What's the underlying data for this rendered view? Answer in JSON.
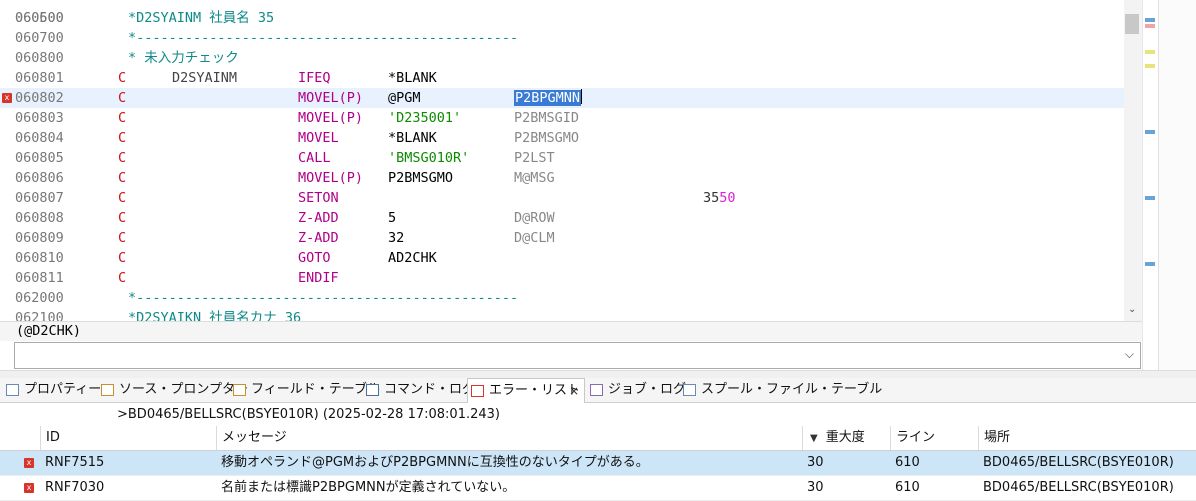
{
  "editor": {
    "top_partial": "060500",
    "lines": [
      {
        "seq": "060600",
        "type": "comment",
        "text": "*D2SYAINM 社員名 35"
      },
      {
        "seq": "060700",
        "type": "comment",
        "text": "*-----------------------------------------------"
      },
      {
        "seq": "060800",
        "type": "comment",
        "text": "* 未入力チェック"
      },
      {
        "seq": "060801",
        "type": "calc",
        "spec": "C",
        "f1": "D2SYAINM",
        "op": "IFEQ",
        "f2": "*BLANK",
        "res": "",
        "ind": ""
      },
      {
        "seq": "060802",
        "type": "calc",
        "error": true,
        "current": true,
        "spec": "C",
        "f1": "",
        "op": "MOVEL(P)",
        "f2": "@PGM",
        "res": "P2BPGMNN",
        "selected": true
      },
      {
        "seq": "060803",
        "type": "calc",
        "spec": "C",
        "f1": "",
        "op": "MOVEL(P)",
        "f2": "'D235001'",
        "literal": true,
        "res": "P2BMSGID"
      },
      {
        "seq": "060804",
        "type": "calc",
        "spec": "C",
        "f1": "",
        "op": "MOVEL",
        "f2": "*BLANK",
        "res": "P2BMSGMO"
      },
      {
        "seq": "060805",
        "type": "calc",
        "spec": "C",
        "f1": "",
        "op": "CALL",
        "f2": "'BMSG010R'",
        "literal": true,
        "res": "P2LST"
      },
      {
        "seq": "060806",
        "type": "calc",
        "spec": "C",
        "f1": "",
        "op": "MOVEL(P)",
        "f2": "P2BMSGMO",
        "res": "M@MSG"
      },
      {
        "seq": "060807",
        "type": "calc",
        "spec": "C",
        "f1": "",
        "op": "SETON",
        "f2": "",
        "res": "",
        "ind": "35",
        "ind2": "50"
      },
      {
        "seq": "060808",
        "type": "calc",
        "spec": "C",
        "f1": "",
        "op": "Z-ADD",
        "f2": "5",
        "res": "D@ROW"
      },
      {
        "seq": "060809",
        "type": "calc",
        "spec": "C",
        "f1": "",
        "op": "Z-ADD",
        "f2": "32",
        "res": "D@CLM"
      },
      {
        "seq": "060810",
        "type": "calc",
        "spec": "C",
        "f1": "",
        "op": "GOTO",
        "f2": "AD2CHK",
        "res": ""
      },
      {
        "seq": "060811",
        "type": "calc",
        "spec": "C",
        "f1": "",
        "op": "ENDIF",
        "f2": "",
        "res": ""
      },
      {
        "seq": "062000",
        "type": "comment",
        "text": "*-----------------------------------------------"
      },
      {
        "seq": "062100",
        "type": "comment",
        "text": "*D2SYAIKN 社員名カナ 36"
      }
    ]
  },
  "field_label": "(@D2CHK)",
  "field_input": {
    "value": "",
    "dropdown_icon": "chevron-down-icon"
  },
  "tabs": [
    {
      "label": "プロパティー",
      "icon": "properties-icon"
    },
    {
      "label": "ソース・プロンプター",
      "icon": "prompter-icon"
    },
    {
      "label": "フィールド・テーブル",
      "icon": "table-icon"
    },
    {
      "label": "コマンド・ログ",
      "icon": "command-log-icon"
    },
    {
      "label": "エラー・リスト",
      "icon": "error-list-icon",
      "active": true,
      "close": "×"
    },
    {
      "label": "ジョブ・ログ",
      "icon": "job-log-icon"
    },
    {
      "label": "スプール・ファイル・テーブル",
      "icon": "spool-icon"
    }
  ],
  "error_list": {
    "source_line": ">BD0465/BELLSRC(BSYE010R) (2025-02-28 17:08:01.243)",
    "columns": [
      "ID",
      "メッセージ",
      "重大度",
      "ライン",
      "場所"
    ],
    "sort_indicator": "▼",
    "rows": [
      {
        "id": "RNF7515",
        "message": "移動オペランド@PGMおよびP2BPGMNNに互換性のないタイプがある。",
        "severity": "30",
        "line": "610",
        "location": "BD0465/BELLSRC(BSYE010R)",
        "selected": true
      },
      {
        "id": "RNF7030",
        "message": "名前または標識P2BPGMNNが定義されていない。",
        "severity": "30",
        "line": "610",
        "location": "BD0465/BELLSRC(BSYE010R)"
      }
    ]
  },
  "colors": {
    "spec_c": "#d0121b",
    "opcode": "#b0008a",
    "comment": "#0e8a8a",
    "literal": "#0c8a00",
    "selection": "#3a7bd5",
    "error": "#d9342b",
    "selected_row": "#cde6f7"
  }
}
